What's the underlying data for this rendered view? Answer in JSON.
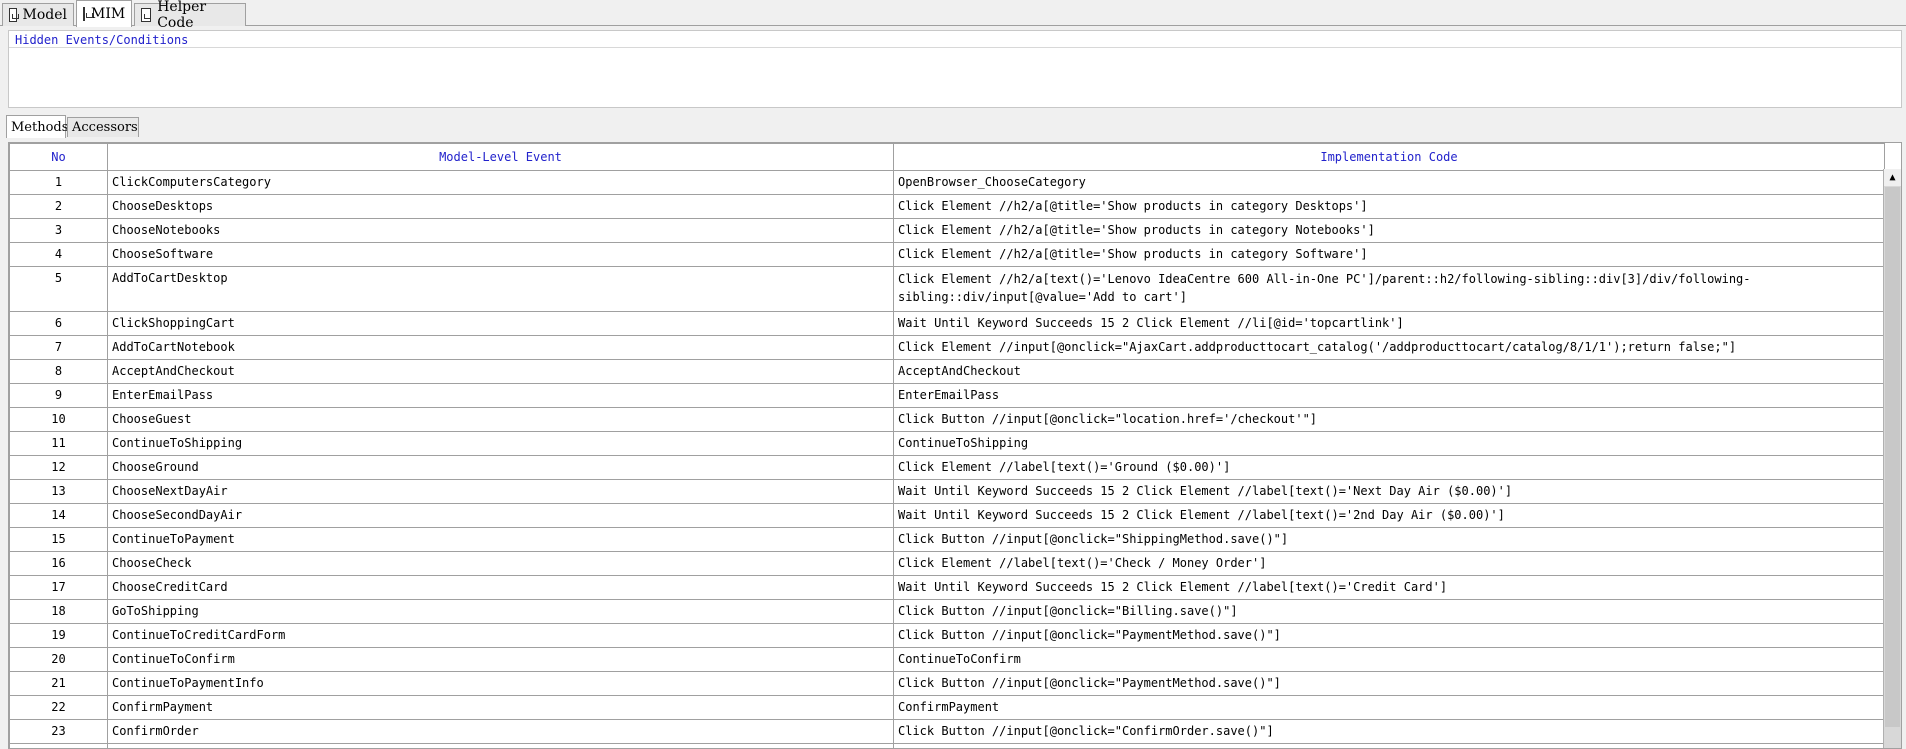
{
  "doc_tabs": [
    {
      "label": "Model",
      "icon": "document-icon"
    },
    {
      "label": "MIM",
      "icon": "document-icon"
    },
    {
      "label": "Helper Code",
      "icon": "document-icon"
    }
  ],
  "hidden_panel": {
    "label": "Hidden Events/Conditions"
  },
  "sub_tabs": [
    {
      "label": "Methods"
    },
    {
      "label": "Accessors"
    }
  ],
  "table": {
    "columns": [
      "No",
      "Model-Level Event",
      "Implementation Code"
    ],
    "rows": [
      {
        "no": "1",
        "event": "ClickComputersCategory",
        "code": "OpenBrowser_ChooseCategory"
      },
      {
        "no": "2",
        "event": "ChooseDesktops",
        "code": "Click Element   //h2/a[@title='Show products in category Desktops']"
      },
      {
        "no": "3",
        "event": "ChooseNotebooks",
        "code": "Click Element   //h2/a[@title='Show products in category Notebooks']"
      },
      {
        "no": "4",
        "event": "ChooseSoftware",
        "code": "Click Element   //h2/a[@title='Show products in category Software']"
      },
      {
        "no": "5",
        "event": "AddToCartDesktop",
        "code": "Click Element   //h2/a[text()='Lenovo IdeaCentre 600 All-in-One PC']/parent::h2/following-sibling::div[3]/div/following-sibling::div/input[@value='Add to cart']"
      },
      {
        "no": "6",
        "event": "ClickShoppingCart",
        "code": "Wait Until Keyword Succeeds   15     2   Click Element   //li[@id='topcartlink']"
      },
      {
        "no": "7",
        "event": "AddToCartNotebook",
        "code": "Click Element  //input[@onclick=\"AjaxCart.addproducttocart_catalog('/addproducttocart/catalog/8/1/1');return false;\"]"
      },
      {
        "no": "8",
        "event": "AcceptAndCheckout",
        "code": "AcceptAndCheckout"
      },
      {
        "no": "9",
        "event": "EnterEmailPass",
        "code": "EnterEmailPass"
      },
      {
        "no": "10",
        "event": "ChooseGuest",
        "code": "Click Button    //input[@onclick=\"location.href='/checkout'\"]"
      },
      {
        "no": "11",
        "event": "ContinueToShipping",
        "code": "ContinueToShipping"
      },
      {
        "no": "12",
        "event": "ChooseGround",
        "code": "Click Element    //label[text()='Ground ($0.00)']"
      },
      {
        "no": "13",
        "event": "ChooseNextDayAir",
        "code": "Wait Until Keyword Succeeds   15      2     Click Element    //label[text()='Next Day Air ($0.00)']"
      },
      {
        "no": "14",
        "event": "ChooseSecondDayAir",
        "code": "Wait Until Keyword Succeeds   15      2     Click Element    //label[text()='2nd Day Air ($0.00)']"
      },
      {
        "no": "15",
        "event": "ContinueToPayment",
        "code": "Click Button     //input[@onclick=\"ShippingMethod.save()\"]"
      },
      {
        "no": "16",
        "event": "ChooseCheck",
        "code": "Click Element    //label[text()='Check / Money Order']"
      },
      {
        "no": "17",
        "event": "ChooseCreditCard",
        "code": "Wait Until Keyword Succeeds   15      2     Click Element    //label[text()='Credit Card']"
      },
      {
        "no": "18",
        "event": "GoToShipping",
        "code": "Click Button     //input[@onclick=\"Billing.save()\"]"
      },
      {
        "no": "19",
        "event": "ContinueToCreditCardForm",
        "code": "Click Button    //input[@onclick=\"PaymentMethod.save()\"]"
      },
      {
        "no": "20",
        "event": "ContinueToConfirm",
        "code": "ContinueToConfirm"
      },
      {
        "no": "21",
        "event": "ContinueToPaymentInfo",
        "code": "Click Button    //input[@onclick=\"PaymentMethod.save()\"]"
      },
      {
        "no": "22",
        "event": "ConfirmPayment",
        "code": "ConfirmPayment"
      },
      {
        "no": "23",
        "event": "ConfirmOrder",
        "code": "Click Button    //input[@onclick=\"ConfirmOrder.save()\"]"
      },
      {
        "no": "24",
        "event": "",
        "code": ""
      }
    ]
  },
  "scrollbar": {
    "up_icon": "arrow-up-icon"
  }
}
